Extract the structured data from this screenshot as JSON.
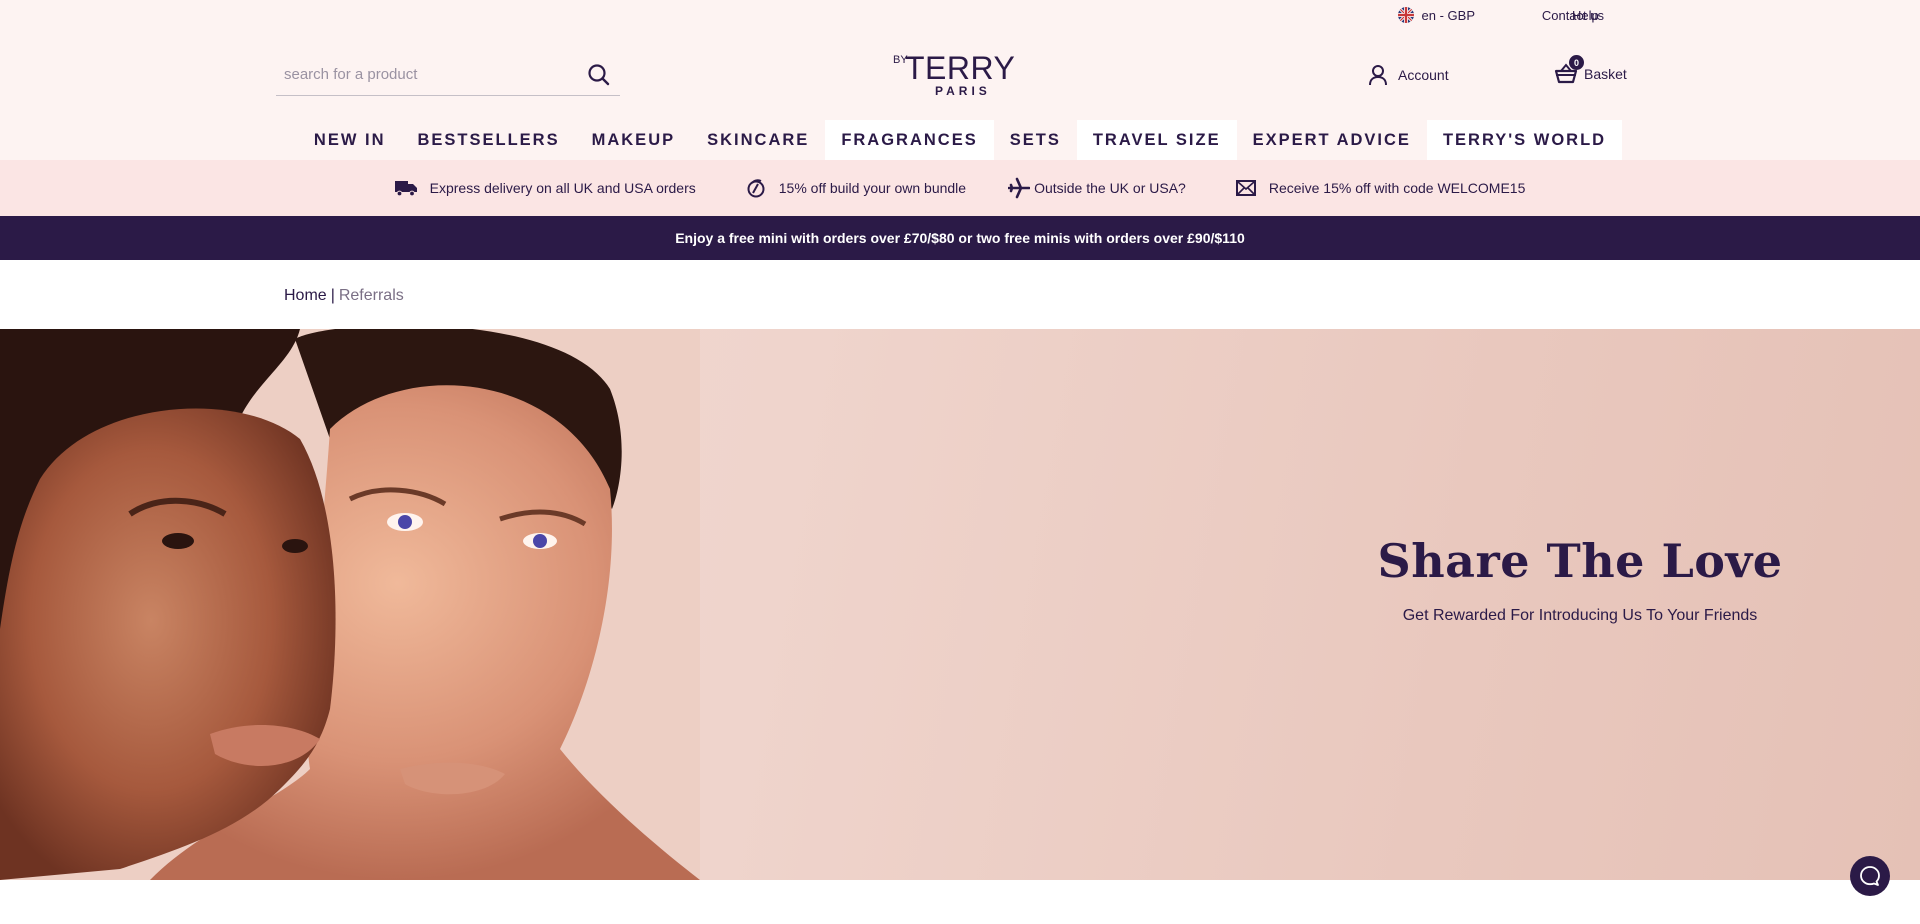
{
  "utility_bar": {
    "locale": "en - GBP",
    "locale_icon": "uk-flag-icon",
    "contact": "Contact us",
    "help": "Help"
  },
  "header": {
    "search": {
      "placeholder": "search for a product",
      "value": "",
      "icon": "search-icon"
    },
    "logo": {
      "by": "BY",
      "brand": "TERRY",
      "sub": "PARIS"
    },
    "account": {
      "label": "Account",
      "icon": "user-icon"
    },
    "basket": {
      "label": "Basket",
      "count": "0",
      "icon": "basket-icon"
    }
  },
  "nav": {
    "items": [
      {
        "label": "NEW IN",
        "highlighted": false
      },
      {
        "label": "BESTSELLERS",
        "highlighted": false
      },
      {
        "label": "MAKEUP",
        "highlighted": false
      },
      {
        "label": "SKINCARE",
        "highlighted": false
      },
      {
        "label": "FRAGRANCES",
        "highlighted": true
      },
      {
        "label": "SETS",
        "highlighted": false
      },
      {
        "label": "TRAVEL SIZE",
        "highlighted": true
      },
      {
        "label": "EXPERT ADVICE",
        "highlighted": false
      },
      {
        "label": "TERRY'S WORLD",
        "highlighted": true
      }
    ]
  },
  "usp_bar": {
    "items": [
      {
        "icon": "truck-icon",
        "label": "Express delivery on all UK and USA orders"
      },
      {
        "icon": "discount-icon",
        "label": "15% off build your own bundle"
      },
      {
        "icon": "airplane-icon",
        "label": "Outside the UK or USA?"
      },
      {
        "icon": "envelope-icon",
        "label": "Receive 15% off with code WELCOME15"
      }
    ]
  },
  "promo_banner": {
    "text": "Enjoy a free mini with orders over £70/$80 or two free minis with orders over £90/$110"
  },
  "breadcrumb": {
    "home": "Home",
    "separator": "|",
    "current": "Referrals"
  },
  "hero": {
    "title": "Share The Love",
    "subtitle": "Get Rewarded For Introducing Us To Your Friends",
    "image_alt": "Two models with glowing skin posing cheek to cheek"
  },
  "chat": {
    "icon": "chat-bubble-icon"
  },
  "colors": {
    "brand_primary": "#2b1a47",
    "header_bg": "#fdf3f2",
    "usp_bg": "#fbe5e4",
    "hero_bg": "#efd4cc"
  }
}
